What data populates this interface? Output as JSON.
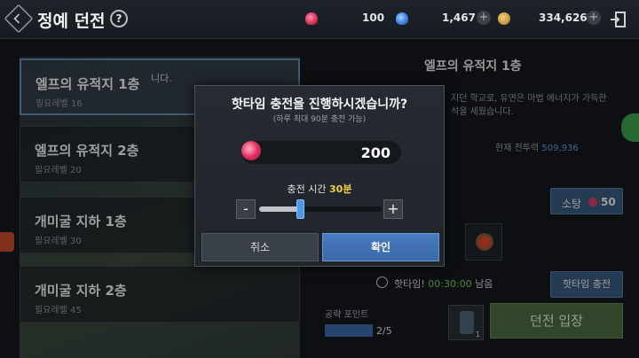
{
  "header": {
    "title": "정예 던전",
    "currencies": [
      {
        "icon": "red-gem-icon",
        "value": "100",
        "color": "#d84060"
      },
      {
        "icon": "blue-gem-icon",
        "value": "1,467",
        "color": "#4a8ae0"
      },
      {
        "icon": "gold-coin-icon",
        "value": "334,626",
        "color": "#c89a40"
      }
    ]
  },
  "dungeons": [
    {
      "name": "엘프의 유적지 1층",
      "req": "필요레벨 16",
      "selected": true
    },
    {
      "name": "엘프의 유적지 2층",
      "req": "필요레벨 20",
      "selected": false
    },
    {
      "name": "개미굴 지하 1층",
      "req": "필요레벨 30",
      "selected": false
    },
    {
      "name": "개미굴 지하 2층",
      "req": "필요레벨 45",
      "selected": false
    }
  ],
  "list_partial_text": "니다.",
  "detail": {
    "title": "엘프의 유적지 1층",
    "desc_line1": "지던 학교로, 유연은 마법 에너지가 가득한",
    "desc_line2": "석을 세웠습니다.",
    "power_label": "현재 전투력",
    "power_value": "509,936",
    "sweep_label": "소탕",
    "sweep_cost": "50",
    "hottime_prefix": "핫타임!",
    "hottime_time": "00:30:00",
    "hottime_suffix": "남음",
    "hottime_button": "핫타임 충전",
    "attack_label": "공략 포인트",
    "attack_value": "2/5",
    "attack_fraction": 0.4,
    "item_count": "1",
    "enter_button": "던전 입장"
  },
  "dialog": {
    "title": "핫타임 충전을 진행하시겠습니까?",
    "subtitle": "(하루 최대 90분 충전 가능)",
    "amount": "200",
    "charge_label": "충전 시간",
    "charge_value": "30분",
    "slider_fraction": 0.33,
    "minus": "-",
    "plus": "+",
    "cancel": "취소",
    "confirm": "확인"
  }
}
